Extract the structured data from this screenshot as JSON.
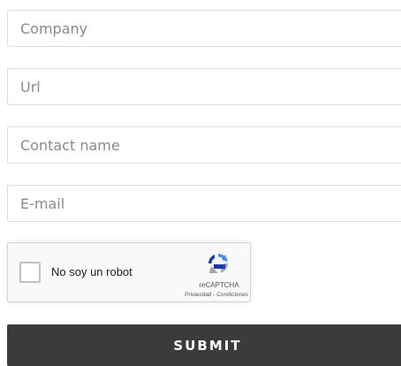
{
  "form": {
    "company_placeholder": "Company",
    "url_placeholder": "Url",
    "contact_placeholder": "Contact name",
    "email_placeholder": "E-mail",
    "submit_label": "SUBMIT"
  },
  "recaptcha": {
    "label": "No soy un robot",
    "brand": "reCAPTCHA",
    "privacy": "Privacidad",
    "separator": " - ",
    "terms": "Condiciones",
    "icon": "recaptcha-logo-icon"
  },
  "colors": {
    "submit_background": "#3b3b3b",
    "field_border": "#dcdcdc",
    "placeholder_text": "#8a8a8a",
    "recaptcha_background": "#f9f9f9",
    "recaptcha_blue": "#4a90e2",
    "recaptcha_dark_blue": "#1c3aa9",
    "recaptcha_gray": "#a6a6a6"
  }
}
